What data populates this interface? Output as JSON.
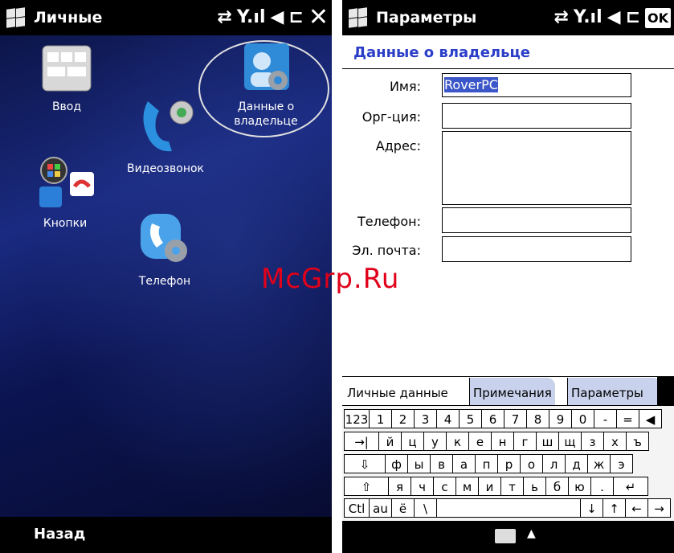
{
  "left": {
    "title": "Личные",
    "apps": [
      {
        "label": "Ввод",
        "icon": "keyboard-icon"
      },
      {
        "label": "Данные о владельце",
        "icon": "owner-info-icon"
      },
      {
        "label": "Видеозвонок",
        "icon": "videocall-icon"
      },
      {
        "label": "Кнопки",
        "icon": "buttons-icon"
      },
      {
        "label": "Телефон",
        "icon": "phone-settings-icon"
      }
    ],
    "owner_label_line1": "Данные о",
    "owner_label_line2": "владельце",
    "back": "Назад"
  },
  "right": {
    "title": "Параметры",
    "ok": "OK",
    "header": "Данные о владельце",
    "fields": {
      "name_label": "Имя:",
      "name_value": "RoverPC",
      "org_label": "Орг-ция:",
      "org_value": "",
      "address_label": "Адрес:",
      "address_value": "",
      "phone_label": "Телефон:",
      "phone_value": "",
      "email_label": "Эл. почта:",
      "email_value": ""
    },
    "tabs": [
      "Личные данные",
      "Примечания",
      "Параметры"
    ],
    "keyboard": {
      "row1": [
        "123",
        "1",
        "2",
        "3",
        "4",
        "5",
        "6",
        "7",
        "8",
        "9",
        "0",
        "-",
        "=",
        "◀"
      ],
      "row2": [
        "→|",
        "й",
        "ц",
        "у",
        "к",
        "е",
        "н",
        "г",
        "ш",
        "щ",
        "з",
        "х",
        "ъ"
      ],
      "row3": [
        "⇩",
        "ф",
        "ы",
        "в",
        "а",
        "п",
        "р",
        "о",
        "л",
        "д",
        "ж",
        "э"
      ],
      "row4": [
        "⇧",
        "я",
        "ч",
        "с",
        "м",
        "и",
        "т",
        "ь",
        "б",
        "ю",
        ".",
        "↵"
      ],
      "row5": [
        "Ctl",
        "au",
        "ё",
        "\\",
        "",
        "↓",
        "↑",
        "←",
        "→"
      ]
    }
  },
  "watermark": "McGrp.Ru"
}
